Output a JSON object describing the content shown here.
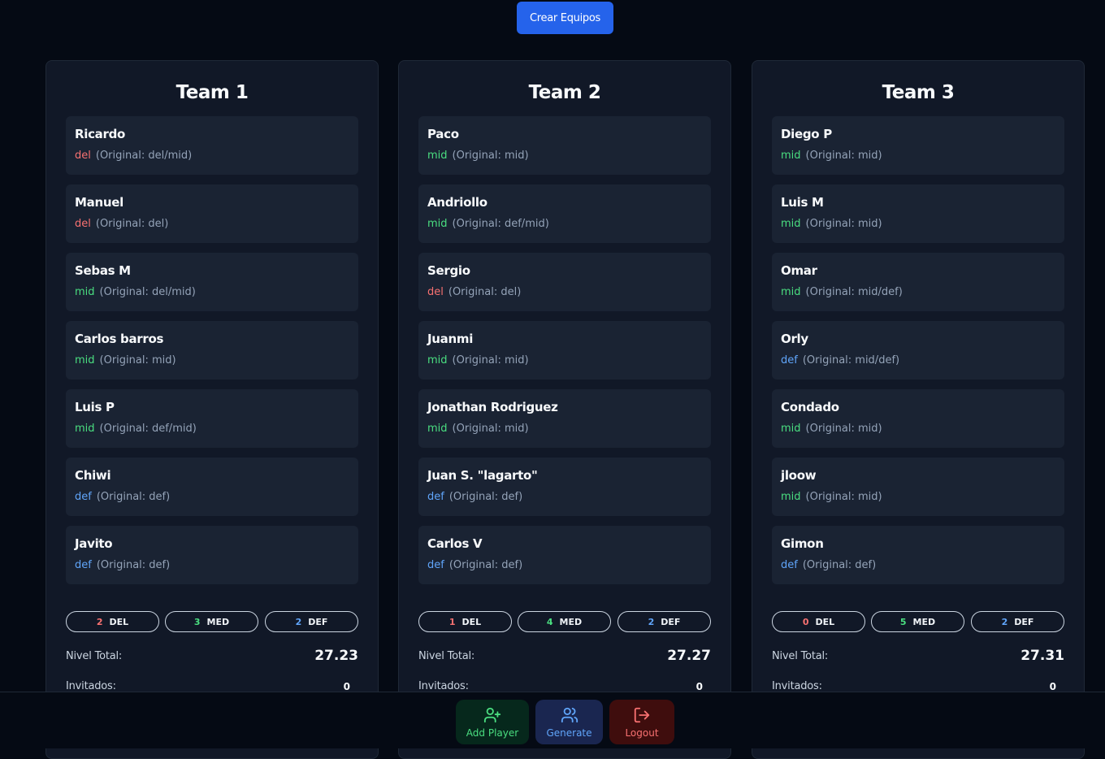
{
  "header": {
    "create_button_label": "Crear Equipos"
  },
  "teams": [
    {
      "name": "Team 1",
      "players": [
        {
          "name": "Ricardo",
          "pos": "del",
          "original": "(Original: del/mid)"
        },
        {
          "name": "Manuel",
          "pos": "del",
          "original": "(Original: del)"
        },
        {
          "name": "Sebas M",
          "pos": "mid",
          "original": "(Original: del/mid)"
        },
        {
          "name": "Carlos barros",
          "pos": "mid",
          "original": "(Original: mid)"
        },
        {
          "name": "Luis P",
          "pos": "mid",
          "original": "(Original: def/mid)"
        },
        {
          "name": "Chiwi",
          "pos": "def",
          "original": "(Original: def)"
        },
        {
          "name": "Javito",
          "pos": "def",
          "original": "(Original: def)"
        }
      ],
      "counts": {
        "del": "2",
        "mid": "3",
        "def": "2"
      },
      "nivel_label": "Nivel Total:",
      "nivel_value": "27.23",
      "invitados_label": "Invitados:",
      "invitados_value": "0"
    },
    {
      "name": "Team 2",
      "players": [
        {
          "name": "Paco",
          "pos": "mid",
          "original": "(Original: mid)"
        },
        {
          "name": "Andriollo",
          "pos": "mid",
          "original": "(Original: def/mid)"
        },
        {
          "name": "Sergio",
          "pos": "del",
          "original": "(Original: del)"
        },
        {
          "name": "Juanmi",
          "pos": "mid",
          "original": "(Original: mid)"
        },
        {
          "name": "Jonathan Rodriguez",
          "pos": "mid",
          "original": "(Original: mid)"
        },
        {
          "name": "Juan S. \"lagarto\"",
          "pos": "def",
          "original": "(Original: def)"
        },
        {
          "name": "Carlos V",
          "pos": "def",
          "original": "(Original: def)"
        }
      ],
      "counts": {
        "del": "1",
        "mid": "4",
        "def": "2"
      },
      "nivel_label": "Nivel Total:",
      "nivel_value": "27.27",
      "invitados_label": "Invitados:",
      "invitados_value": "0"
    },
    {
      "name": "Team 3",
      "players": [
        {
          "name": "Diego P",
          "pos": "mid",
          "original": "(Original: mid)"
        },
        {
          "name": "Luis M",
          "pos": "mid",
          "original": "(Original: mid)"
        },
        {
          "name": "Omar",
          "pos": "mid",
          "original": "(Original: mid/def)"
        },
        {
          "name": "Orly",
          "pos": "def",
          "original": "(Original: mid/def)"
        },
        {
          "name": "Condado",
          "pos": "mid",
          "original": "(Original: mid)"
        },
        {
          "name": "jloow",
          "pos": "mid",
          "original": "(Original: mid)"
        },
        {
          "name": "Gimon",
          "pos": "def",
          "original": "(Original: def)"
        }
      ],
      "counts": {
        "del": "0",
        "mid": "5",
        "def": "2"
      },
      "nivel_label": "Nivel Total:",
      "nivel_value": "27.31",
      "invitados_label": "Invitados:",
      "invitados_value": "0"
    }
  ],
  "badge_labels": {
    "del": "DEL",
    "mid": "MED",
    "def": "DEF"
  },
  "footer": {
    "add_player": {
      "label": "Add Player",
      "icon": "user-plus-icon"
    },
    "generate": {
      "label": "Generate",
      "icon": "users-icon"
    },
    "logout": {
      "label": "Logout",
      "icon": "logout-icon"
    }
  },
  "colors": {
    "background": "#050a14",
    "card": "#111827",
    "player_card": "#1a2333",
    "del": "#f87171",
    "mid": "#4ade80",
    "def": "#60a5fa",
    "primary": "#2563eb"
  }
}
